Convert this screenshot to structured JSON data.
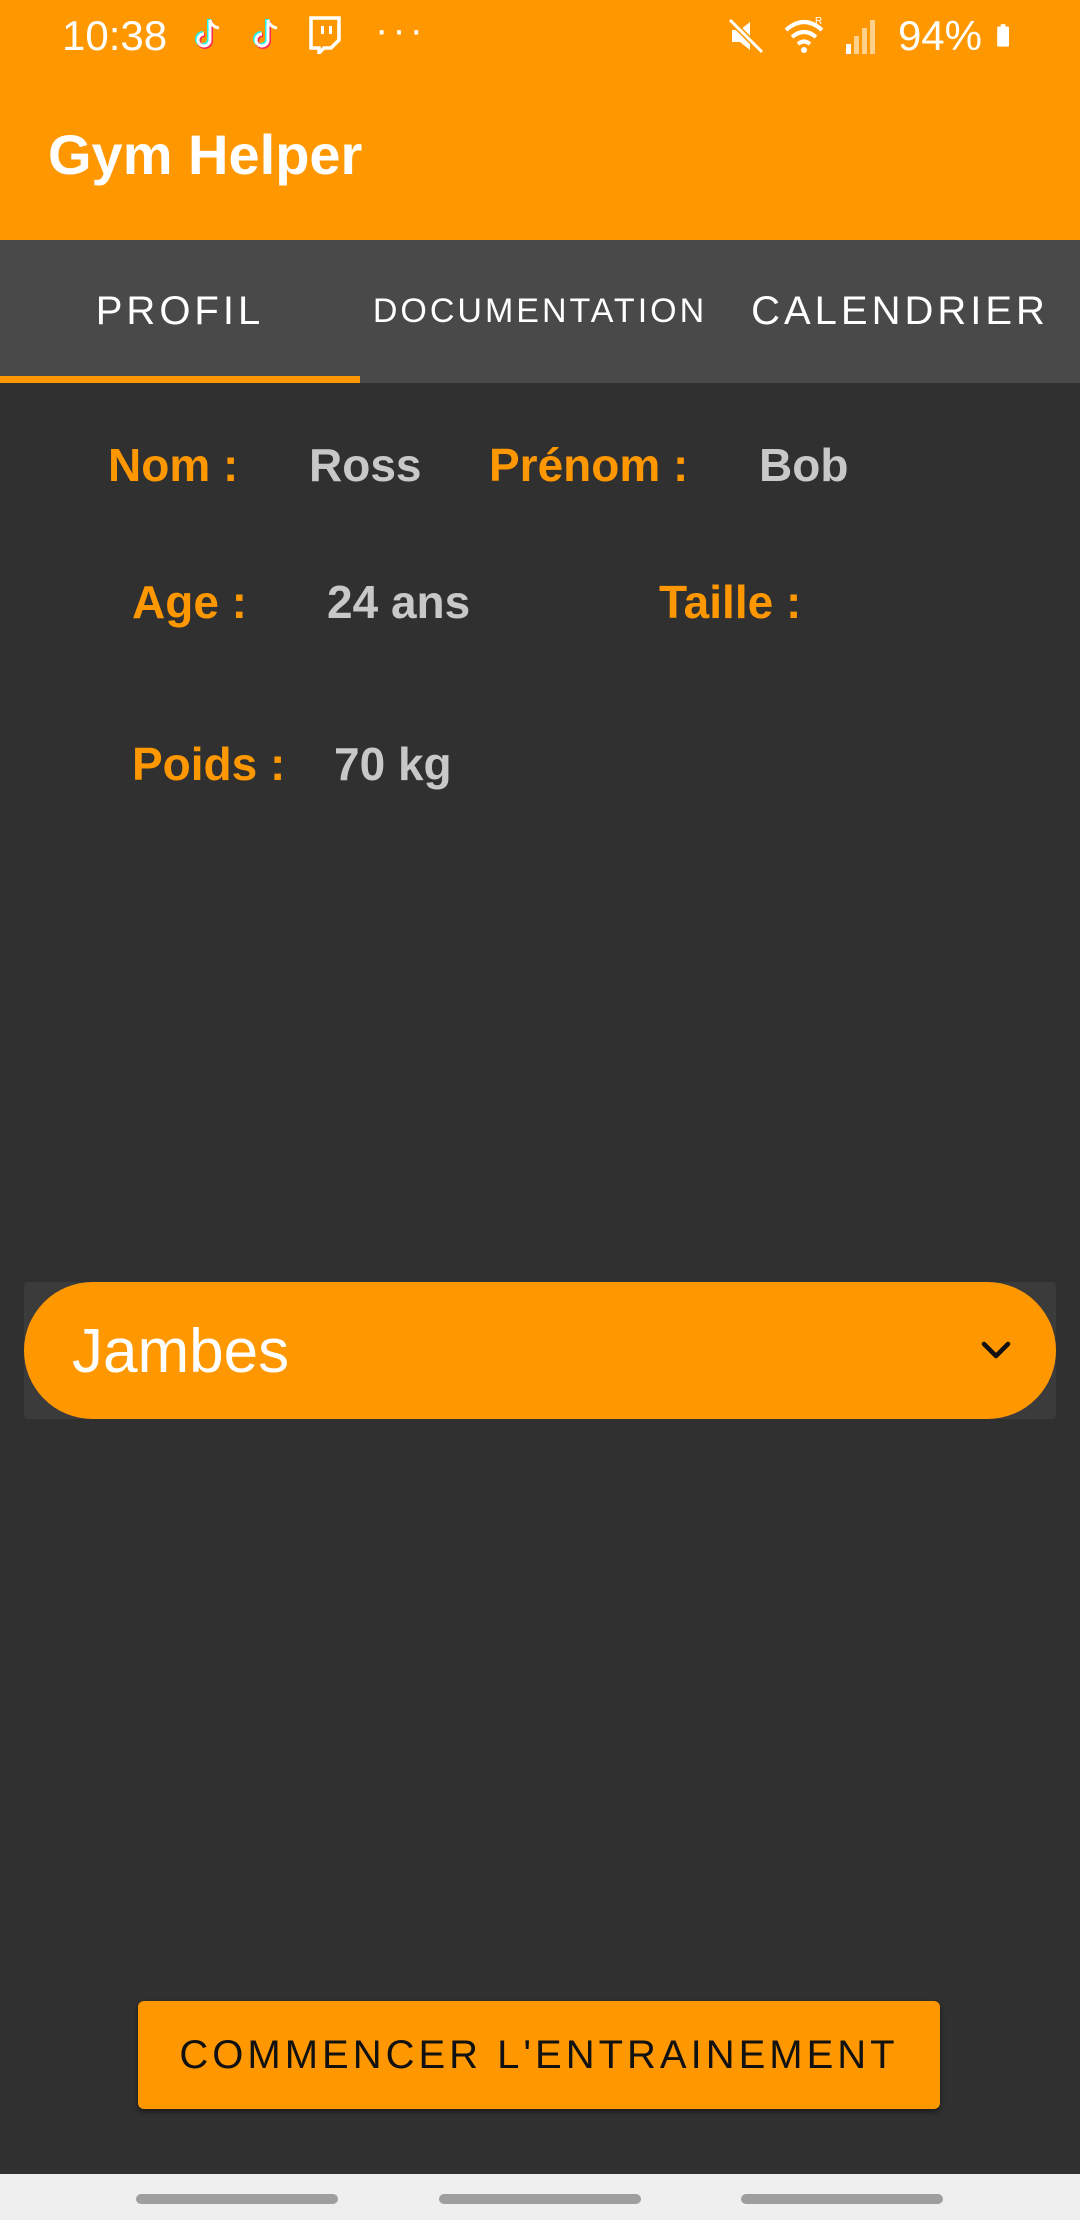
{
  "status_bar": {
    "time": "10:38",
    "more": "···",
    "battery": "94%",
    "notification_icons": [
      "tiktok-icon",
      "tiktok-icon",
      "twitch-icon"
    ],
    "system_icons": [
      "mute-icon",
      "wifi-icon",
      "signal-icon",
      "battery-icon"
    ]
  },
  "app_bar": {
    "title": "Gym Helper"
  },
  "tabs": [
    {
      "label": "PROFIL",
      "selected": true
    },
    {
      "label": "DOCUMENTATION",
      "selected": false
    },
    {
      "label": "CALENDRIER",
      "selected": false
    }
  ],
  "profile": {
    "nom_label": "Nom :",
    "nom_value": "Ross",
    "prenom_label": "Prénom :",
    "prenom_value": "Bob",
    "age_label": "Age :",
    "age_value": "24 ans",
    "taille_label": "Taille :",
    "poids_label": "Poids :",
    "poids_value": "70 kg"
  },
  "spinner": {
    "selected": "Jambes",
    "icon": "chevron-down-icon"
  },
  "start_button": {
    "label": "COMMENCER L'ENTRAINEMENT"
  },
  "colors": {
    "accent": "#FF9800",
    "background": "#303030",
    "tab_bar": "#494949",
    "value_text": "#C8C8C8"
  }
}
